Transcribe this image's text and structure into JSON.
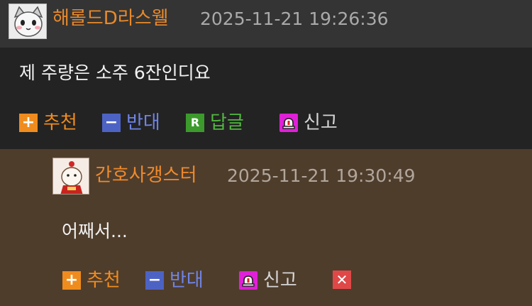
{
  "comment": {
    "author": "해롤드D라스웰",
    "date": "2025-11-21 19:26:36",
    "text": "제 주량은 소주 6잔인디요",
    "actions": {
      "recommend": "추천",
      "oppose": "반대",
      "reply": "답글",
      "report": "신고"
    }
  },
  "reply": {
    "author": "간호사갱스터",
    "date": "2025-11-21 19:30:49",
    "text": "어째서...",
    "actions": {
      "recommend": "추천",
      "oppose": "반대",
      "report": "신고"
    }
  },
  "icons": {
    "plus": "+",
    "minus": "−",
    "reply": "R",
    "delete": "✕"
  },
  "colors": {
    "author": "#e8892a",
    "recommend": "#f08c1e",
    "oppose": "#4d63c4",
    "reply": "#3c9a2c",
    "report": "#e020d8",
    "delete": "#e04848",
    "reply_background": "#4f3d2c"
  }
}
